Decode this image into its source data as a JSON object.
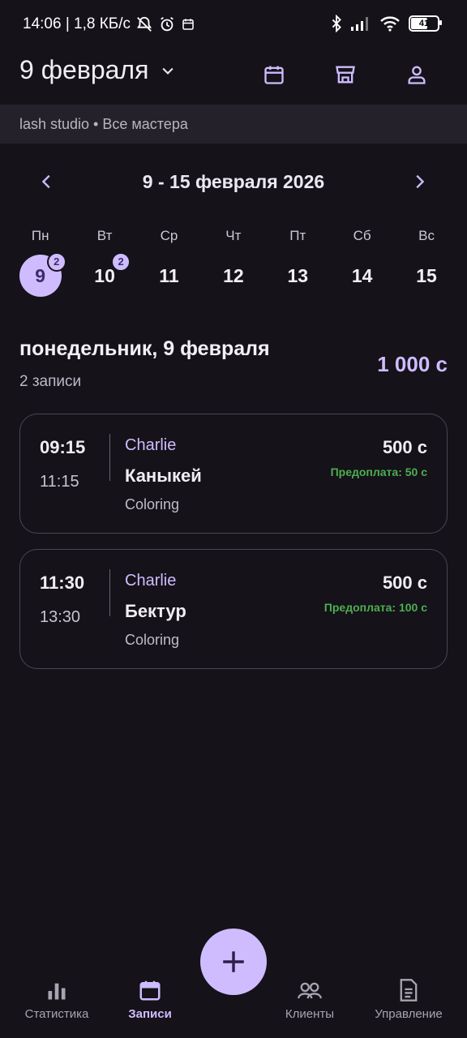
{
  "status_bar": {
    "time_speed": "14:06 | 1,8 КБ/с",
    "battery": "41"
  },
  "header": {
    "date_title": "9 февраля",
    "icons": [
      "calendar-icon",
      "store-icon",
      "person-icon"
    ]
  },
  "studio_bar": {
    "text": "lash studio • Все мастера"
  },
  "week": {
    "label": "9 - 15 февраля 2026",
    "days": [
      {
        "name": "Пн",
        "num": "9",
        "badge": "2",
        "selected": true
      },
      {
        "name": "Вт",
        "num": "10",
        "badge": "2",
        "selected": false
      },
      {
        "name": "Ср",
        "num": "11"
      },
      {
        "name": "Чт",
        "num": "12"
      },
      {
        "name": "Пт",
        "num": "13"
      },
      {
        "name": "Сб",
        "num": "14"
      },
      {
        "name": "Вс",
        "num": "15"
      }
    ]
  },
  "summary": {
    "title": "понедельник, 9 февраля",
    "count": "2 записи",
    "total": "1 000 с"
  },
  "appointments": [
    {
      "start": "09:15",
      "end": "11:15",
      "master": "Charlie",
      "client": "Каныкей",
      "service": "Coloring",
      "price": "500 с",
      "prepayment": "Предоплата: 50 с"
    },
    {
      "start": "11:30",
      "end": "13:30",
      "master": "Charlie",
      "client": "Бектур",
      "service": "Coloring",
      "price": "500 с",
      "prepayment": "Предоплата: 100 с"
    }
  ],
  "bottom_nav": {
    "items": [
      {
        "label": "Статистика",
        "icon": "bar-chart-icon"
      },
      {
        "label": "Записи",
        "icon": "calendar-icon",
        "active": true
      },
      {
        "label": "Клиенты",
        "icon": "people-icon"
      },
      {
        "label": "Управление",
        "icon": "document-icon"
      }
    ]
  },
  "colors": {
    "background": "#151219",
    "accent": "#cebcff",
    "prepay_green": "#4caf50"
  }
}
